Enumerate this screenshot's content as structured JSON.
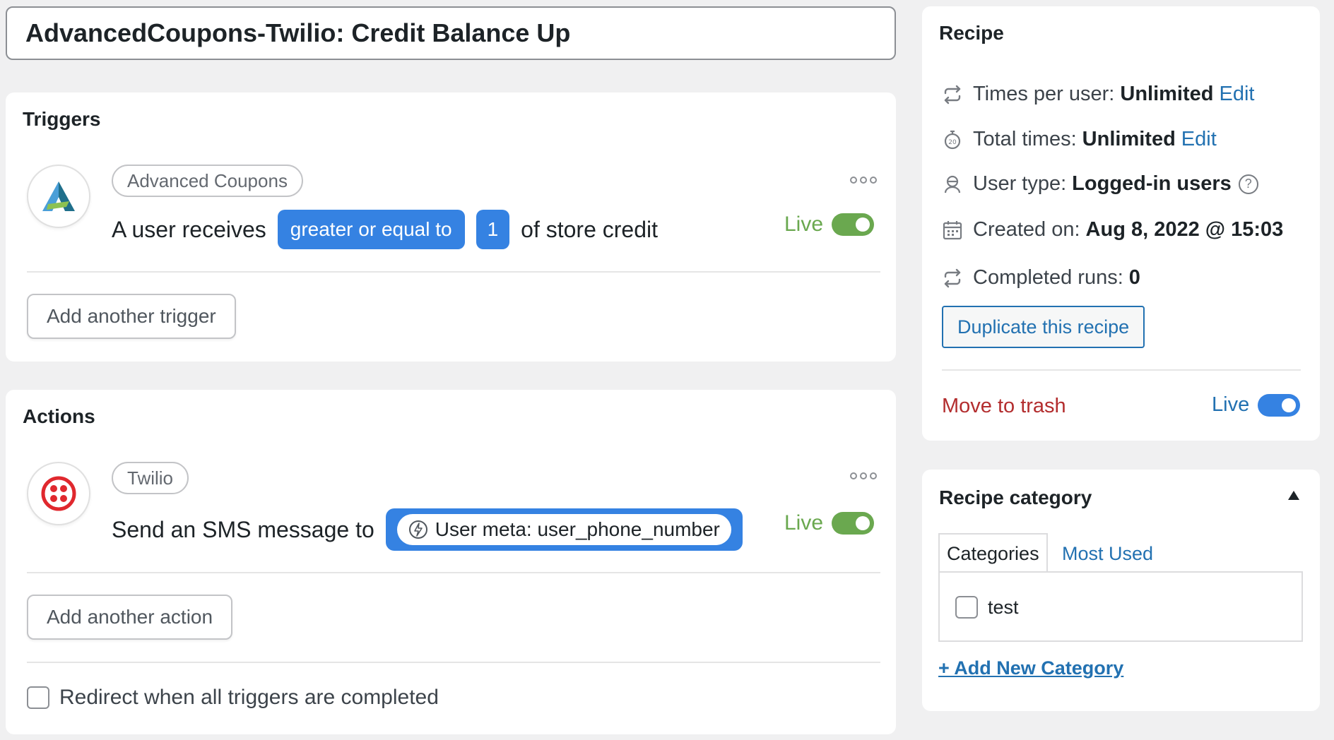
{
  "recipe_title": "AdvancedCoupons-Twilio: Credit Balance Up",
  "triggers": {
    "heading": "Triggers",
    "item": {
      "integration": "Advanced Coupons",
      "sentence_start": "A user receives",
      "operator": "greater or equal to",
      "amount": "1",
      "sentence_end": "of store credit",
      "status": "Live"
    },
    "add_label": "Add another trigger"
  },
  "actions": {
    "heading": "Actions",
    "item": {
      "integration": "Twilio",
      "sentence_start": "Send an SMS message to",
      "token": "User meta: user_phone_number",
      "status": "Live"
    },
    "add_label": "Add another action",
    "redirect_label": "Redirect when all triggers are completed"
  },
  "recipe_box": {
    "heading": "Recipe",
    "times_per_user_label": "Times per user:",
    "times_per_user_value": "Unlimited",
    "total_times_label": "Total times:",
    "total_times_value": "Unlimited",
    "edit_label": "Edit",
    "user_type_label": "User type:",
    "user_type_value": "Logged-in users",
    "created_label": "Created on:",
    "created_value": "Aug 8, 2022 @ 15:03",
    "runs_label": "Completed runs:",
    "runs_value": "0",
    "duplicate_label": "Duplicate this recipe",
    "trash_label": "Move to trash",
    "status": "Live"
  },
  "category_box": {
    "heading": "Recipe category",
    "tab_categories": "Categories",
    "tab_most_used": "Most Used",
    "categories": [
      "test"
    ],
    "add_new": "+ Add New Category"
  },
  "colors": {
    "accent_blue": "#3582e2",
    "live_green": "#6aa84f",
    "link_blue": "#2271b1",
    "trash_red": "#b32d2e"
  }
}
